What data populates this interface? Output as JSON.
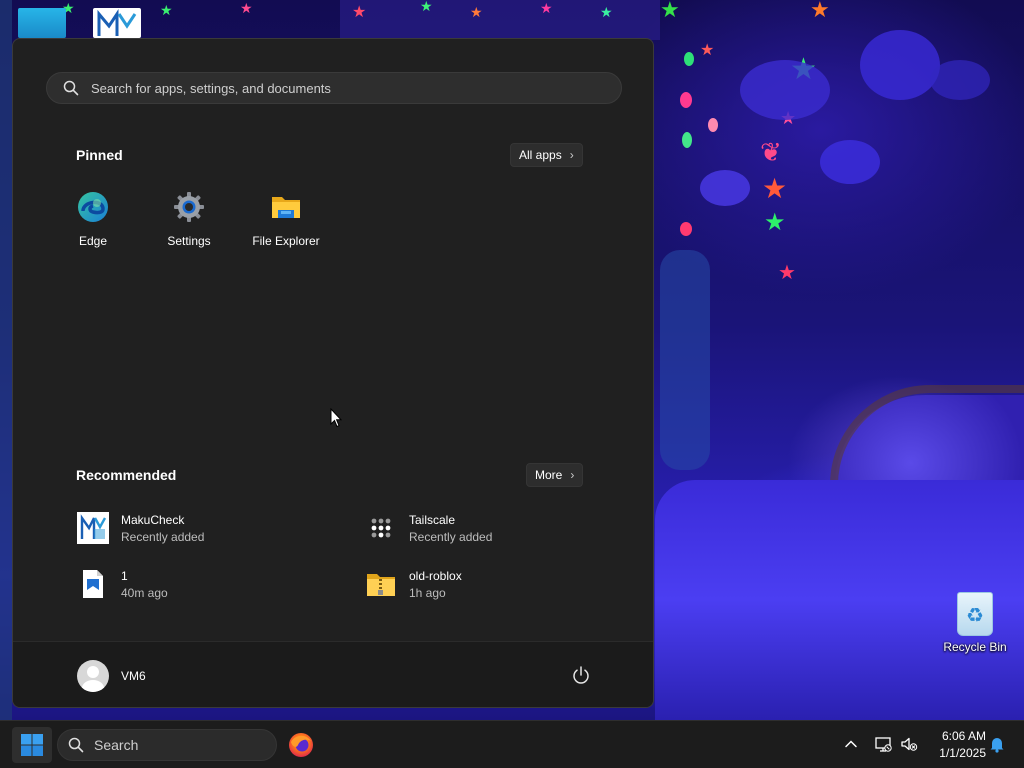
{
  "start_menu": {
    "search_placeholder": "Search for apps, settings, and documents",
    "pinned_title": "Pinned",
    "all_apps_label": "All apps",
    "pinned": [
      {
        "label": "Edge",
        "icon": "edge-icon"
      },
      {
        "label": "Settings",
        "icon": "gear-icon"
      },
      {
        "label": "File Explorer",
        "icon": "folder-icon"
      }
    ],
    "recommended_title": "Recommended",
    "more_label": "More",
    "recommended": [
      {
        "name": "MakuCheck",
        "sub": "Recently added",
        "icon": "makucheck-icon"
      },
      {
        "name": "Tailscale",
        "sub": "Recently added",
        "icon": "tailscale-icon"
      },
      {
        "name": "1",
        "sub": "40m ago",
        "icon": "image-file-icon"
      },
      {
        "name": "old-roblox",
        "sub": "1h ago",
        "icon": "zip-folder-icon"
      }
    ],
    "user_name": "VM6"
  },
  "desktop": {
    "recycle_bin_label": "Recycle Bin"
  },
  "taskbar": {
    "search_label": "Search",
    "time": "6:06 AM",
    "date": "1/1/2025"
  },
  "colors": {
    "menu_bg": "#202020",
    "accent_blue": "#0078d4",
    "taskbar_bg": "#1c1c1c"
  }
}
